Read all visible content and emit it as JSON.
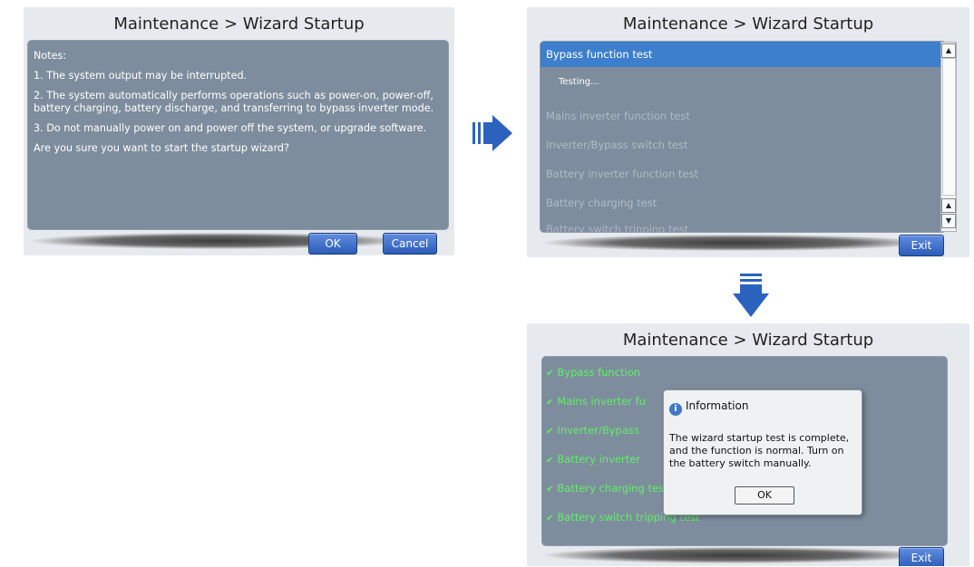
{
  "title": "Maintenance > Wizard Startup",
  "screen1": {
    "notes_heading": "Notes:",
    "notes": [
      "1. The system output may be interrupted.",
      "2. The system automatically performs operations such as power-on, power-off, battery charging, battery discharge, and transferring to bypass inverter mode.",
      "3. Do not manually power on and power off the system, or upgrade software."
    ],
    "question": "Are you sure you want to start the startup wizard?",
    "ok_label": "OK",
    "cancel_label": "Cancel"
  },
  "screen2": {
    "tests": [
      "Bypass function test",
      "Mains inverter function test",
      "Inverter/Bypass switch test",
      "Battery inverter function test",
      "Battery charging test",
      "Battery switch tripping test"
    ],
    "status": "Testing...",
    "exit_label": "Exit"
  },
  "screen3": {
    "results": [
      "Bypass function",
      "Mains inverter fu",
      "Inverter/Bypass",
      "Battery inverter",
      "Battery charging test",
      "Battery switch tripping test"
    ],
    "dialog": {
      "title": "Information",
      "message": "The wizard startup test is complete, and the function is normal. Turn on the battery switch manually.",
      "ok_label": "OK"
    },
    "exit_label": "Exit"
  },
  "colors": {
    "panel": "#7e8d9d",
    "highlight": "#3d7fcc",
    "pass": "#5ff066",
    "button": "#2c5cb8",
    "arrow": "#2b62bd"
  },
  "icons": [
    "info-icon",
    "check-icon",
    "scroll-up-icon",
    "scroll-down-icon",
    "arrow-right-icon",
    "arrow-down-icon"
  ]
}
